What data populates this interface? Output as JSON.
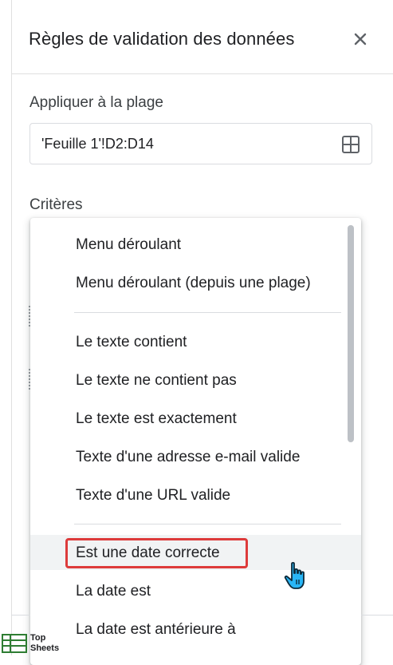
{
  "header": {
    "title": "Règles de validation des données",
    "close_icon": "close-icon"
  },
  "range": {
    "label": "Appliquer à la plage",
    "value": "'Feuille 1'!D2:D14",
    "icon": "grid-select-icon"
  },
  "criteria": {
    "label": "Critères"
  },
  "dropdown": {
    "options": [
      "Menu déroulant",
      "Menu déroulant (depuis une plage)",
      "Le texte contient",
      "Le texte ne contient pas",
      "Le texte est exactement",
      "Texte d'une adresse e-mail valide",
      "Texte d'une URL valide",
      "Est une date correcte",
      "La date est",
      "La date est antérieure à"
    ],
    "highlighted": "Est une date correcte",
    "highlight_color": "#dd3b3b"
  },
  "watermark": {
    "line1": "Top",
    "line2": "Sheets",
    "color": "#2e7d32"
  }
}
